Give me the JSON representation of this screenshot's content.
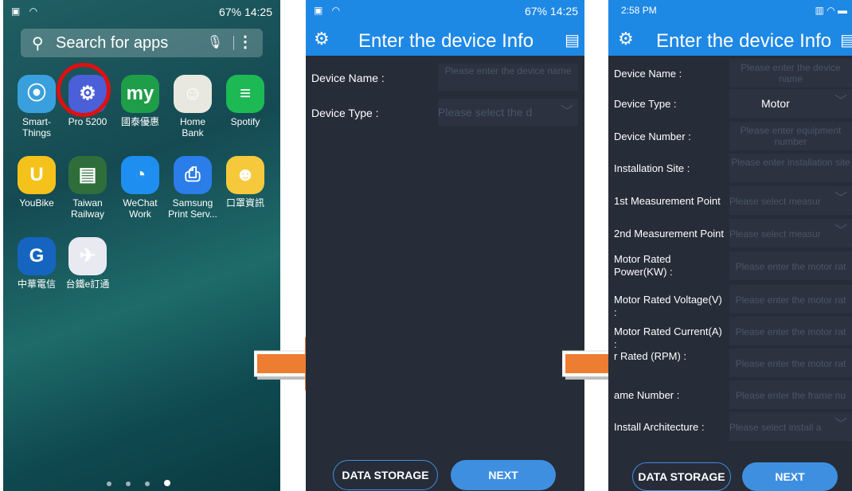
{
  "phone1": {
    "status_right": "67% 14:25",
    "search_placeholder": "Search for apps",
    "apps": [
      {
        "label": "Smart-\nThings",
        "color": "#3aa0dd",
        "glyph": "⦿"
      },
      {
        "label": "Pro 5200",
        "color": "#4b5fd8",
        "glyph": "⚙"
      },
      {
        "label": "國泰優惠",
        "color": "#1f9e4a",
        "glyph": "my"
      },
      {
        "label": "Home\nBank",
        "color": "#e8e8e0",
        "glyph": "☺"
      },
      {
        "label": "Spotify",
        "color": "#1db954",
        "glyph": "≡"
      },
      {
        "label": "YouBike",
        "color": "#f4c21a",
        "glyph": "U"
      },
      {
        "label": "Taiwan\nRailway",
        "color": "#2f6e3a",
        "glyph": "▤"
      },
      {
        "label": "WeChat\nWork",
        "color": "#1e8ff0",
        "glyph": "◔"
      },
      {
        "label": "Samsung\nPrint Serv...",
        "color": "#2b7de9",
        "glyph": "⎙"
      },
      {
        "label": "口罩資訊",
        "color": "#f6c93d",
        "glyph": "☻"
      },
      {
        "label": "中華電信",
        "color": "#1565c0",
        "glyph": "G"
      },
      {
        "label": "台鐵e訂通",
        "color": "#e9e9f2",
        "glyph": "✈"
      }
    ]
  },
  "phone2": {
    "status_right": "67% 14:25",
    "title": "Enter the device Info",
    "fields": [
      {
        "label": "Device Name :",
        "placeholder": "Please enter the device name"
      },
      {
        "label": "Device Type :",
        "placeholder": "Please select the d"
      }
    ],
    "data_storage_label": "DATA STORAGE",
    "next_label": "NEXT"
  },
  "phone3": {
    "status_left": "2:58 PM",
    "title": "Enter the device Info",
    "fields": [
      {
        "label": "Device Name :",
        "placeholder": "Please enter the device name"
      },
      {
        "label": "Device Type :",
        "value": "Motor"
      },
      {
        "label": "Device Number :",
        "placeholder": "Please enter equipment number"
      },
      {
        "label": "Installation Site :",
        "placeholder": "Please enter installation site"
      },
      {
        "label": "1st Measurement Point",
        "placeholder": "Please select measur"
      },
      {
        "label": "2nd Measurement Point",
        "placeholder": "Please select measur"
      },
      {
        "label": "Motor Rated Power(KW) :",
        "placeholder": "Please enter the motor rat"
      },
      {
        "label": "Motor Rated Voltage(V) :",
        "placeholder": "Please enter the motor rat"
      },
      {
        "label": "Motor Rated Current(A) :",
        "placeholder": "Please enter the motor rat"
      },
      {
        "label": "r Rated (RPM) :",
        "placeholder": "Please enter the motor rat"
      },
      {
        "label": "ame Number :",
        "placeholder": "Please enter the frame nu"
      },
      {
        "label": "Install Architecture :",
        "placeholder": "Please select install a"
      }
    ],
    "data_storage_label": "DATA STORAGE",
    "next_label": "NEXT"
  },
  "colors": {
    "accent": "#1e88e5",
    "arrow": "#ed7d31",
    "dark_bg": "#262c38",
    "ring": "#e01010"
  }
}
